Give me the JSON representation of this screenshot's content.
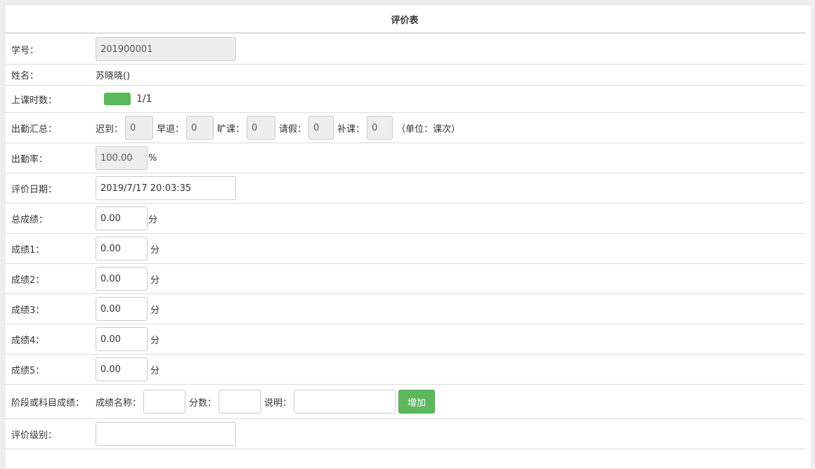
{
  "title": "评价表",
  "student_id": {
    "label": "学号：",
    "value": "201900001"
  },
  "name": {
    "label": "姓名：",
    "value": "苏晓晓()"
  },
  "class_hours": {
    "label": "上课时数：",
    "attended": "1",
    "total": "/1",
    "progress_fraction": 1.0,
    "progress_color": "#5cb85c"
  },
  "attendance": {
    "label": "出勤汇总：",
    "late_label": "迟到：",
    "late": "0",
    "early_label": "早退：",
    "early": "0",
    "absent_label": "旷课：",
    "absent": "0",
    "leave_label": "请假：",
    "leave": "0",
    "makeup_label": "补课：",
    "makeup": "0",
    "unit_note": "（单位：课次）"
  },
  "attendance_rate": {
    "label": "出勤率：",
    "value": "100.00",
    "unit": "%"
  },
  "eval_date": {
    "label": "评价日期：",
    "value": "2019/7/17 20:03:35"
  },
  "total_score": {
    "label": "总成绩：",
    "value": "0.00",
    "unit": "分"
  },
  "scores": [
    {
      "label": "成绩1：",
      "value": "0.00",
      "unit": "分"
    },
    {
      "label": "成绩2：",
      "value": "0.00",
      "unit": "分"
    },
    {
      "label": "成绩3：",
      "value": "0.00",
      "unit": "分"
    },
    {
      "label": "成绩4：",
      "value": "0.00",
      "unit": "分"
    },
    {
      "label": "成绩5：",
      "value": "0.00",
      "unit": "分"
    }
  ],
  "stage_score": {
    "label": "阶段或科目成绩：",
    "name_label": "成绩名称：",
    "name_value": "",
    "score_label": "分数：",
    "score_value": "",
    "note_label": "说明：",
    "note_value": "",
    "add_button": "增加",
    "button_color": "#5cb85c"
  },
  "eval_level": {
    "label": "评价级别：",
    "value": ""
  }
}
